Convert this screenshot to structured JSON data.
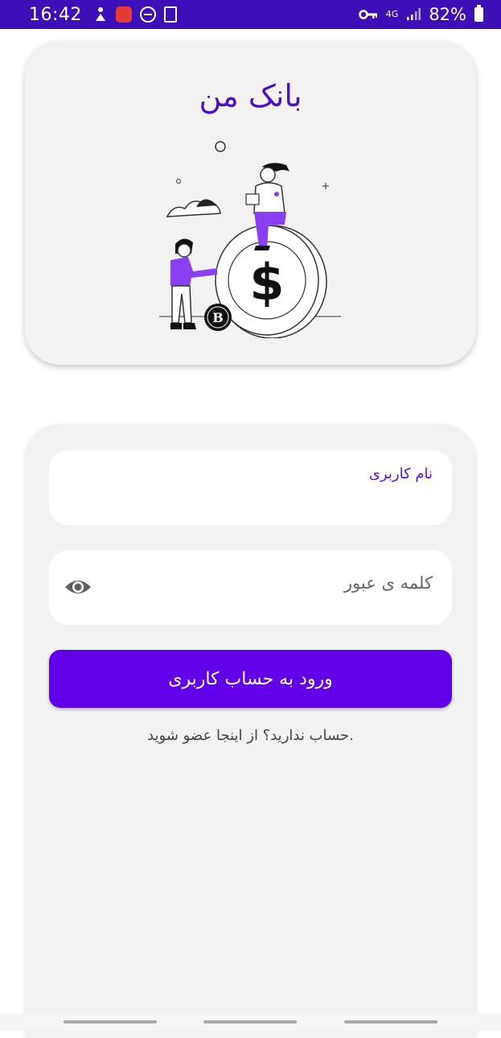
{
  "status_bar": {
    "time": "16:42",
    "network": "4G",
    "battery": "82%"
  },
  "app": {
    "title": "بانک من"
  },
  "login_form": {
    "username_label": "نام کاربری",
    "password_placeholder": "کلمه ی عبور",
    "login_button": "ورود به حساب کاربری",
    "signup_text": "حساب ندارید؟ از اینجا عضو شوید."
  },
  "illustration": {
    "coin_symbol": "$",
    "small_coin_symbol": "B"
  },
  "colors": {
    "status_bar": "#3d0fb6",
    "accent": "#6200ea",
    "title": "#4b0fc4",
    "card_bg": "#f2f2f2"
  }
}
